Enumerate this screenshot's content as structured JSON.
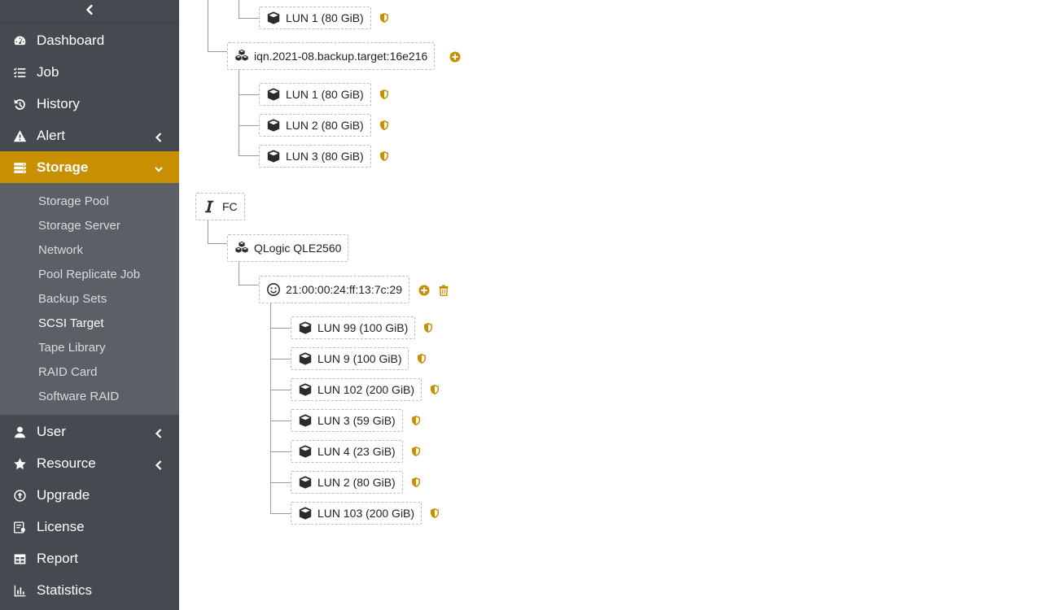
{
  "sidebar": {
    "items": [
      {
        "label": "Dashboard",
        "icon": "dashboard-icon"
      },
      {
        "label": "Job",
        "icon": "job-list-icon"
      },
      {
        "label": "History",
        "icon": "history-icon"
      },
      {
        "label": "Alert",
        "icon": "alert-icon"
      },
      {
        "label": "Storage",
        "icon": "storage-icon",
        "active": true
      },
      {
        "label": "User",
        "icon": "user-icon"
      },
      {
        "label": "Resource",
        "icon": "star-icon"
      },
      {
        "label": "Upgrade",
        "icon": "upgrade-icon"
      },
      {
        "label": "License",
        "icon": "license-icon"
      },
      {
        "label": "Report",
        "icon": "report-icon"
      },
      {
        "label": "Statistics",
        "icon": "statistics-icon"
      }
    ],
    "storage_sub": [
      "Storage Pool",
      "Storage Server",
      "Network",
      "Pool Replicate Job",
      "Backup Sets",
      "SCSI Target",
      "Tape Library",
      "RAID Card",
      "Software RAID"
    ],
    "current_sub": "SCSI Target"
  },
  "tree": {
    "top_lun": "LUN 1 (80 GiB)",
    "iscsi_target": "iqn.2021-08.backup.target:16e216",
    "iscsi_luns": [
      "LUN 1 (80 GiB)",
      "LUN 2 (80 GiB)",
      "LUN 3 (80 GiB)"
    ],
    "fc_label": "FC",
    "fc_adapter": "QLogic QLE2560",
    "fc_port": "21:00:00:24:ff:13:7c:29",
    "fc_luns": [
      "LUN 99 (100 GiB)",
      "LUN 9 (100 GiB)",
      "LUN 102 (200 GiB)",
      "LUN 3 (59 GiB)",
      "LUN 4 (23 GiB)",
      "LUN 2 (80 GiB)",
      "LUN 103 (200 GiB)"
    ]
  },
  "colors": {
    "accent": "#c89000",
    "sidebar_bg": "#444a4f",
    "subnav_bg": "#5a6066"
  }
}
